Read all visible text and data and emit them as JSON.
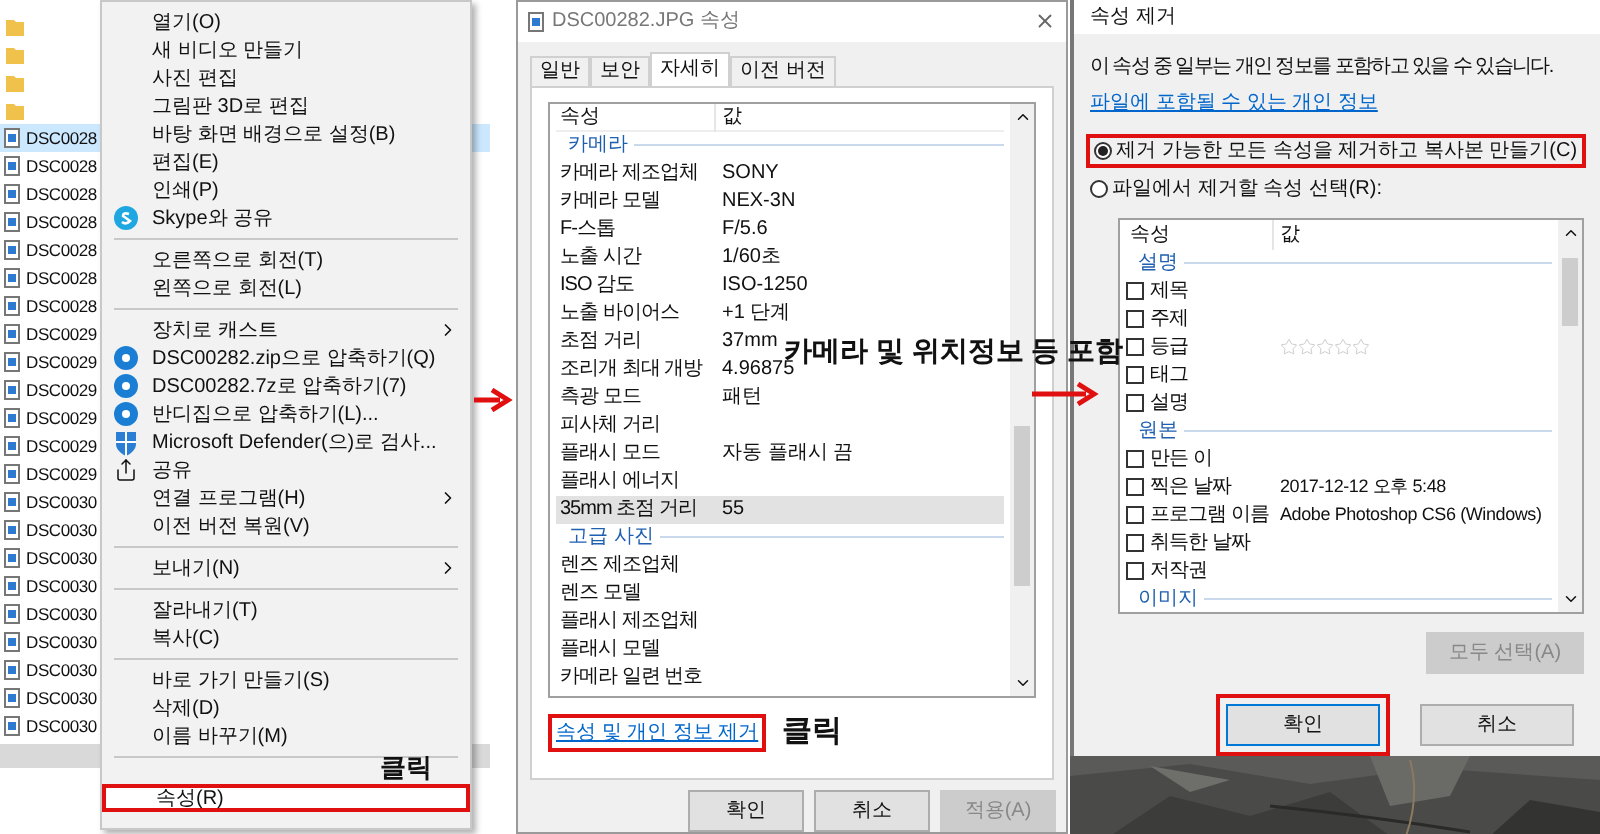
{
  "explorer": {
    "items": [
      {
        "kind": "folder"
      },
      {
        "kind": "folder"
      },
      {
        "kind": "folder"
      },
      {
        "kind": "folder"
      },
      {
        "kind": "file",
        "name": "DSC0028",
        "selected": true
      },
      {
        "kind": "file",
        "name": "DSC0028",
        "selected": false
      },
      {
        "kind": "file",
        "name": "DSC0028",
        "selected": false
      },
      {
        "kind": "file",
        "name": "DSC0028",
        "selected": false
      },
      {
        "kind": "file",
        "name": "DSC0028",
        "selected": false
      },
      {
        "kind": "file",
        "name": "DSC0028",
        "selected": false
      },
      {
        "kind": "file",
        "name": "DSC0028",
        "selected": false
      },
      {
        "kind": "file",
        "name": "DSC0029",
        "selected": false
      },
      {
        "kind": "file",
        "name": "DSC0029",
        "selected": false
      },
      {
        "kind": "file",
        "name": "DSC0029",
        "selected": false
      },
      {
        "kind": "file",
        "name": "DSC0029",
        "selected": false
      },
      {
        "kind": "file",
        "name": "DSC0029",
        "selected": false
      },
      {
        "kind": "file",
        "name": "DSC0029",
        "selected": false
      },
      {
        "kind": "file",
        "name": "DSC0030",
        "selected": false
      },
      {
        "kind": "file",
        "name": "DSC0030",
        "selected": false
      },
      {
        "kind": "file",
        "name": "DSC0030",
        "selected": false
      },
      {
        "kind": "file",
        "name": "DSC0030",
        "selected": false
      },
      {
        "kind": "file",
        "name": "DSC0030",
        "selected": false
      },
      {
        "kind": "file",
        "name": "DSC0030",
        "selected": false
      },
      {
        "kind": "file",
        "name": "DSC0030",
        "selected": false
      },
      {
        "kind": "file",
        "name": "DSC0030",
        "selected": false
      },
      {
        "kind": "file",
        "name": "DSC0030",
        "selected": false
      }
    ]
  },
  "context_menu": {
    "items": [
      {
        "kind": "item",
        "label": "열기(O)",
        "boxed": false
      },
      {
        "kind": "item",
        "label": "새 비디오 만들기",
        "boxed": false
      },
      {
        "kind": "item",
        "label": "사진 편집",
        "boxed": false
      },
      {
        "kind": "item",
        "label": "그림판 3D로 편집",
        "boxed": false
      },
      {
        "kind": "item",
        "label": "바탕 화면 배경으로 설정(B)",
        "boxed": false
      },
      {
        "kind": "item",
        "label": "편집(E)",
        "boxed": false
      },
      {
        "kind": "item",
        "label": "인쇄(P)",
        "boxed": false
      },
      {
        "kind": "icon-item",
        "label": "Skype와 공유",
        "boxed": false
      },
      {
        "kind": "separator"
      },
      {
        "kind": "item",
        "label": "오른쪽으로 회전(T)",
        "boxed": false
      },
      {
        "kind": "item",
        "label": "왼쪽으로 회전(L)",
        "boxed": false
      },
      {
        "kind": "separator"
      },
      {
        "kind": "submenu",
        "label": "장치로 캐스트",
        "boxed": false
      },
      {
        "kind": "icon-item",
        "label": "DSC00282.zip으로 압축하기(Q)",
        "boxed": false
      },
      {
        "kind": "icon-item",
        "label": "DSC00282.7z로 압축하기(7)",
        "boxed": false
      },
      {
        "kind": "icon-item",
        "label": "반디집으로 압축하기(L)...",
        "boxed": false
      },
      {
        "kind": "icon-item",
        "label": "Microsoft Defender(으)로 검사...",
        "boxed": false
      },
      {
        "kind": "icon-item",
        "label": "공유",
        "boxed": false
      },
      {
        "kind": "submenu",
        "label": "연결 프로그램(H)",
        "boxed": false
      },
      {
        "kind": "item",
        "label": "이전 버전 복원(V)",
        "boxed": false
      },
      {
        "kind": "separator"
      },
      {
        "kind": "submenu",
        "label": "보내기(N)",
        "boxed": false
      },
      {
        "kind": "separator"
      },
      {
        "kind": "item",
        "label": "잘라내기(T)",
        "boxed": false
      },
      {
        "kind": "item",
        "label": "복사(C)",
        "boxed": false
      },
      {
        "kind": "separator"
      },
      {
        "kind": "item",
        "label": "바로 가기 만들기(S)",
        "boxed": false
      },
      {
        "kind": "item",
        "label": "삭제(D)",
        "boxed": false
      },
      {
        "kind": "item",
        "label": "이름 바꾸기(M)",
        "boxed": false
      },
      {
        "kind": "separator"
      },
      {
        "kind": "item",
        "label": "속성(R)",
        "boxed": true
      }
    ]
  },
  "properties_dialog": {
    "title": "DSC00282.JPG 속성",
    "tabs": [
      {
        "label": "일반",
        "selected": false
      },
      {
        "label": "보안",
        "selected": false
      },
      {
        "label": "자세히",
        "selected": true
      },
      {
        "label": "이전 버전",
        "selected": false
      }
    ],
    "columns": [
      "속성",
      "값"
    ],
    "rows": [
      {
        "kind": "group",
        "label": "카메라"
      },
      {
        "kind": "row",
        "name": "카메라 제조업체",
        "value": "SONY",
        "selected": false
      },
      {
        "kind": "row",
        "name": "카메라 모델",
        "value": "NEX-3N",
        "selected": false
      },
      {
        "kind": "row",
        "name": "F-스톱",
        "value": "F/5.6",
        "selected": false
      },
      {
        "kind": "row",
        "name": "노출 시간",
        "value": "1/60초",
        "selected": false
      },
      {
        "kind": "row",
        "name": "ISO 감도",
        "value": "ISO-1250",
        "selected": false
      },
      {
        "kind": "row",
        "name": "노출 바이어스",
        "value": "+1 단계",
        "selected": false
      },
      {
        "kind": "row",
        "name": "초점 거리",
        "value": "37mm",
        "selected": false
      },
      {
        "kind": "row",
        "name": "조리개 최대 개방",
        "value": "4.96875",
        "selected": false
      },
      {
        "kind": "row",
        "name": "측광 모드",
        "value": "패턴",
        "selected": false
      },
      {
        "kind": "row",
        "name": "피사체 거리",
        "selected": false
      },
      {
        "kind": "row",
        "name": "플래시 모드",
        "value": "자동 플래시 끔",
        "selected": false
      },
      {
        "kind": "row",
        "name": "플래시 에너지",
        "selected": false
      },
      {
        "kind": "row",
        "name": "35mm 초점 거리",
        "value": "55",
        "selected": true
      },
      {
        "kind": "group",
        "label": "고급 사진"
      },
      {
        "kind": "row",
        "name": "렌즈 제조업체",
        "selected": false
      },
      {
        "kind": "row",
        "name": "렌즈 모델",
        "selected": false
      },
      {
        "kind": "row",
        "name": "플래시 제조업체",
        "selected": false
      },
      {
        "kind": "row",
        "name": "플래시 모델",
        "selected": false
      },
      {
        "kind": "row",
        "name": "카메라 일련 번호",
        "selected": false
      }
    ],
    "link": {
      "text": "속성 및 개인 정보 제거",
      "boxed": true
    },
    "buttons": [
      {
        "label": "확인",
        "disabled": false
      },
      {
        "label": "취소",
        "disabled": false
      },
      {
        "label": "적용(A)",
        "disabled": true
      }
    ]
  },
  "remove_dialog": {
    "title": "속성 제거",
    "message": "이 속성 중 일부는 개인 정보를 포함하고 있을 수 있습니다.",
    "link": "파일에 포함될 수 있는 개인 정보",
    "options": [
      {
        "label": "제거 가능한 모든 속성을 제거하고 복사본 만들기(C)",
        "selected": true,
        "boxed": true
      },
      {
        "label": "파일에서 제거할 속성 선택(R):",
        "selected": false,
        "boxed": false
      }
    ],
    "columns": [
      "속성",
      "값"
    ],
    "rows": [
      {
        "kind": "group",
        "label": "설명"
      },
      {
        "kind": "check",
        "name": "제목",
        "checked": false
      },
      {
        "kind": "check",
        "name": "주제",
        "checked": false
      },
      {
        "kind": "check",
        "name": "등급",
        "checked": false,
        "stars": 0
      },
      {
        "kind": "check",
        "name": "태그",
        "checked": false
      },
      {
        "kind": "check",
        "name": "설명",
        "checked": false
      },
      {
        "kind": "group",
        "label": "원본"
      },
      {
        "kind": "check",
        "name": "만든 이",
        "checked": false
      },
      {
        "kind": "check",
        "name": "찍은 날짜",
        "checked": false,
        "value": "2017-12-12 오후 5:48"
      },
      {
        "kind": "check",
        "name": "프로그램 이름",
        "checked": false,
        "value": "Adobe Photoshop CS6 (Windows)"
      },
      {
        "kind": "check",
        "name": "취득한 날짜",
        "checked": false
      },
      {
        "kind": "check",
        "name": "저작권",
        "checked": false
      },
      {
        "kind": "group",
        "label": "이미지"
      }
    ],
    "select_all": {
      "label": "모두 선택(A)",
      "disabled": true
    },
    "buttons": [
      {
        "label": "확인",
        "boxed": true,
        "focused": true
      },
      {
        "label": "취소",
        "boxed": false,
        "focused": false
      }
    ]
  },
  "annotations": [
    {
      "text": "클릭"
    },
    {
      "text": "클릭"
    },
    {
      "text": "카메라 및 위치정보 등 포함"
    }
  ]
}
